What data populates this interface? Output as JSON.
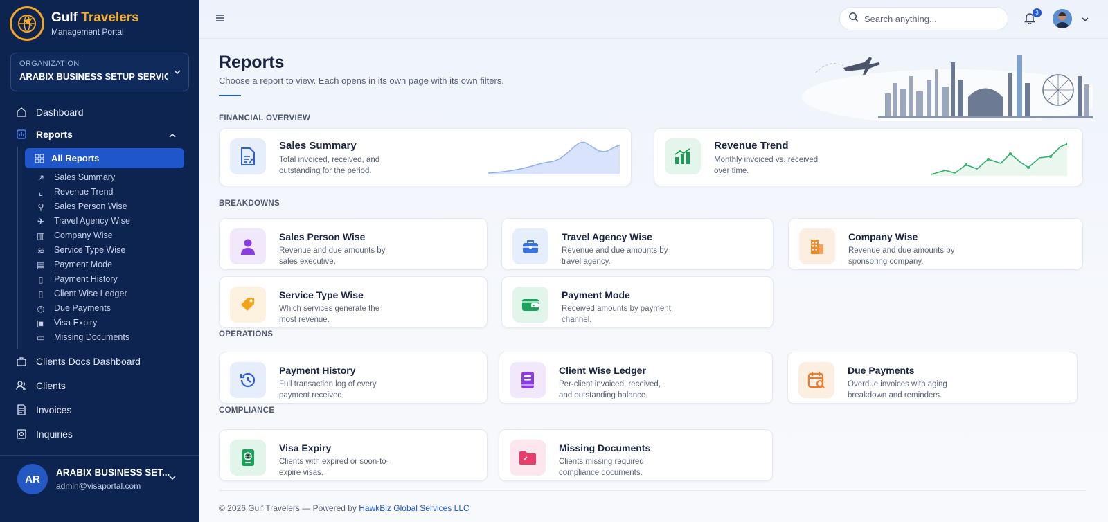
{
  "brand": {
    "title_main": "Gulf",
    "title_accent": "Travelers",
    "subtitle": "Management Portal"
  },
  "organization": {
    "label": "ORGANIZATION",
    "name": "ARABIX BUSINESS SETUP SERVICE..."
  },
  "nav": {
    "dashboard": "Dashboard",
    "reports": "Reports",
    "all_reports": "All Reports",
    "sub_items": [
      "Sales Summary",
      "Revenue Trend",
      "Sales Person Wise",
      "Travel Agency Wise",
      "Company Wise",
      "Service Type Wise",
      "Payment Mode",
      "Payment History",
      "Client Wise Ledger",
      "Due Payments",
      "Visa Expiry",
      "Missing Documents"
    ],
    "clients_docs": "Clients Docs Dashboard",
    "clients": "Clients",
    "invoices": "Invoices",
    "inquiries": "Inquiries"
  },
  "user": {
    "initials": "AR",
    "name": "ARABIX BUSINESS SET...",
    "email": "admin@visaportal.com"
  },
  "topbar": {
    "search_placeholder": "Search anything...",
    "notifications": "3"
  },
  "page": {
    "title": "Reports",
    "subtitle": "Choose a report to view. Each opens in its own page with its own filters."
  },
  "sections": {
    "financial": "FINANCIAL OVERVIEW",
    "breakdowns": "BREAKDOWNS",
    "operations": "OPERATIONS",
    "compliance": "COMPLIANCE"
  },
  "cards": {
    "sales_summary": {
      "title": "Sales Summary",
      "desc": "Total invoiced, received, and outstanding for the period."
    },
    "revenue_trend": {
      "title": "Revenue Trend",
      "desc": "Monthly invoiced vs. received over time."
    },
    "sales_person": {
      "title": "Sales Person Wise",
      "desc": "Revenue and due amounts by sales executive."
    },
    "travel_agency": {
      "title": "Travel Agency Wise",
      "desc": "Revenue and due amounts by travel agency."
    },
    "company": {
      "title": "Company Wise",
      "desc": "Revenue and due amounts by sponsoring company."
    },
    "service_type": {
      "title": "Service Type Wise",
      "desc": "Which services generate the most revenue."
    },
    "payment_mode": {
      "title": "Payment Mode",
      "desc": "Received amounts by payment channel."
    },
    "payment_history": {
      "title": "Payment History",
      "desc": "Full transaction log of every payment received."
    },
    "client_ledger": {
      "title": "Client Wise Ledger",
      "desc": "Per-client invoiced, received, and outstanding balance."
    },
    "due_payments": {
      "title": "Due Payments",
      "desc": "Overdue invoices with aging breakdown and reminders."
    },
    "visa_expiry": {
      "title": "Visa Expiry",
      "desc": "Clients with expired or soon-to-expire visas."
    },
    "missing_docs": {
      "title": "Missing Documents",
      "desc": "Clients missing required compliance documents."
    }
  },
  "footer": {
    "text": "© 2026 Gulf Travelers — Powered by ",
    "link": "HawkBiz Global Services LLC"
  },
  "colors": {
    "sidebar": "#0d2350",
    "accent": "#2056d0",
    "brand_gold": "#f4ad2c"
  }
}
